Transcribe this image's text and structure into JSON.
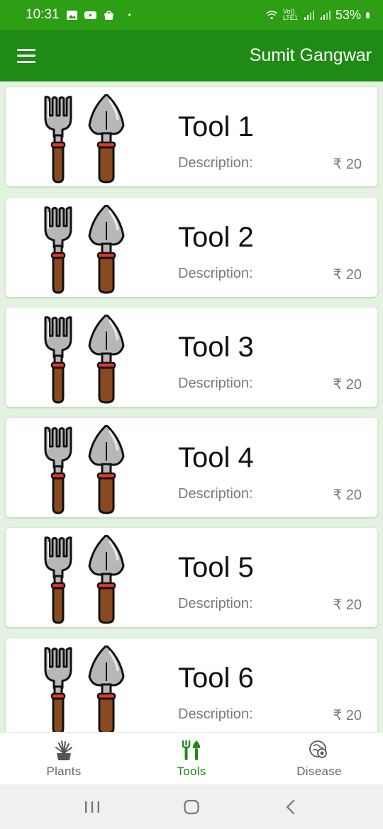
{
  "status_bar": {
    "time": "10:31",
    "dot": "•",
    "network": "Vo)) LTE1",
    "battery": "53%",
    "icons": [
      "gallery-icon",
      "youtube-icon",
      "shopping-bag-icon",
      "wifi-icon",
      "signal-icon",
      "signal-icon",
      "battery-icon"
    ]
  },
  "app_bar": {
    "title": "Sumit Gangwar",
    "menu_icon": "hamburger-menu-icon"
  },
  "tools": [
    {
      "title": "Tool 1",
      "description": "Description:",
      "price": "₹ 20"
    },
    {
      "title": "Tool 2",
      "description": "Description:",
      "price": "₹ 20"
    },
    {
      "title": "Tool 3",
      "description": "Description:",
      "price": "₹ 20"
    },
    {
      "title": "Tool 4",
      "description": "Description:",
      "price": "₹ 20"
    },
    {
      "title": "Tool 5",
      "description": "Description:",
      "price": "₹ 20"
    },
    {
      "title": "Tool 6",
      "description": "Description:",
      "price": "₹ 20"
    }
  ],
  "bottom_nav": {
    "items": [
      {
        "label": "Plants",
        "icon": "plant-icon"
      },
      {
        "label": "Tools",
        "icon": "garden-tools-icon",
        "active": true
      },
      {
        "label": "Disease",
        "icon": "disease-icon"
      }
    ]
  },
  "colors": {
    "status_bar": "#2e9e14",
    "app_bar": "#1f8b14",
    "background": "#e4f2e1",
    "active_tab": "#1f8b14"
  }
}
